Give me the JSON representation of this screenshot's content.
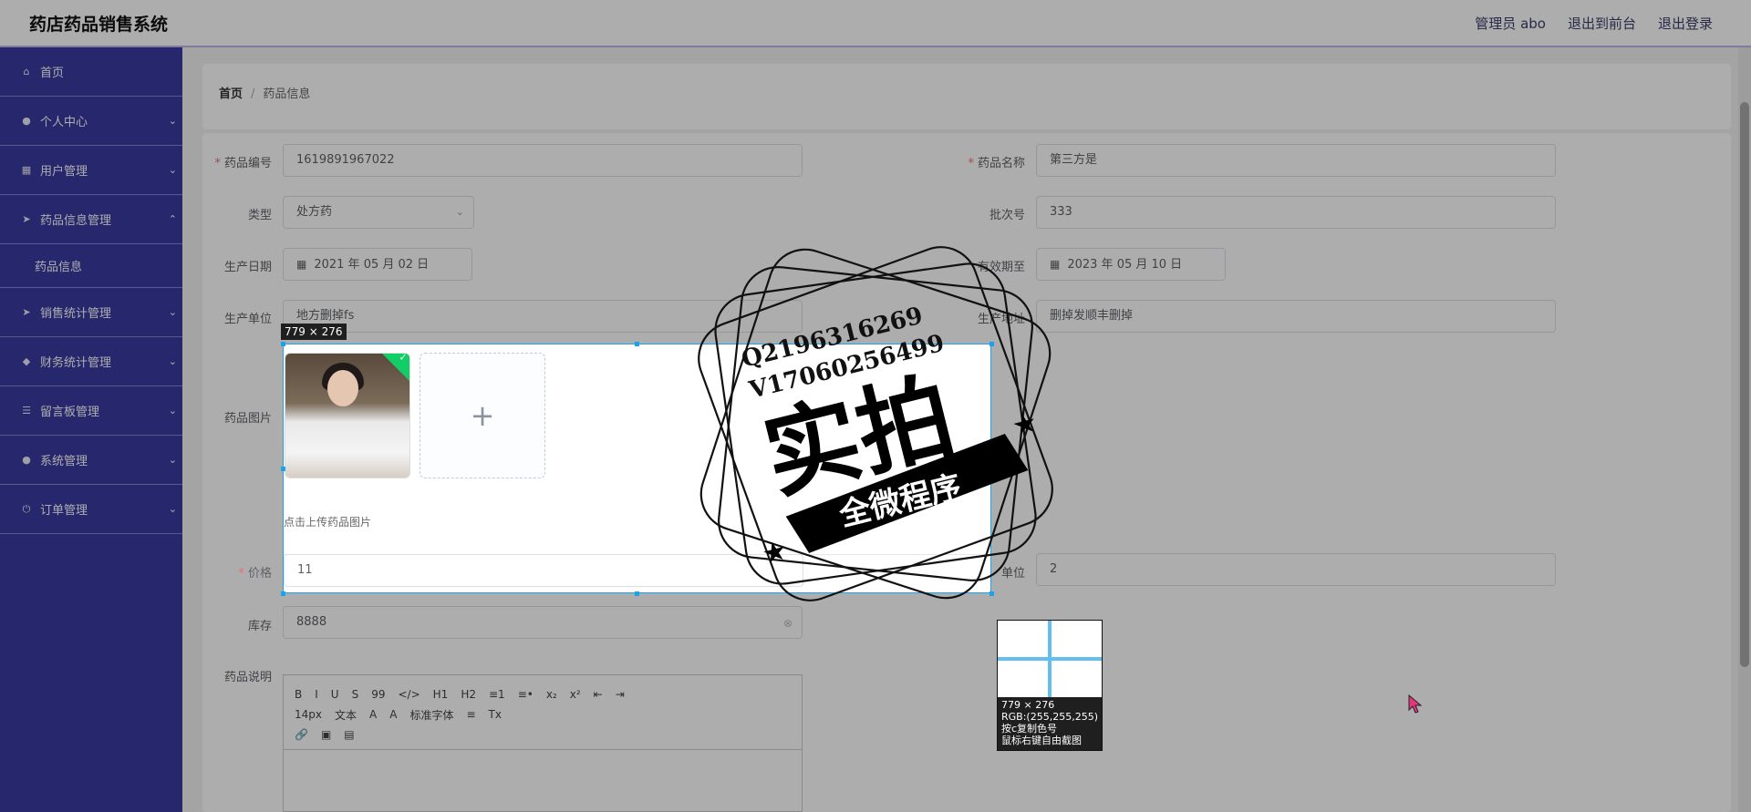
{
  "app": {
    "title": "药店药品销售系统",
    "nav": [
      "管理员 abo",
      "退出到前台",
      "退出登录"
    ]
  },
  "sidebar": {
    "items": [
      {
        "label": "首页",
        "icon": "home-icon"
      },
      {
        "label": "个人中心",
        "icon": "user-icon"
      },
      {
        "label": "用户管理",
        "icon": "grid-icon"
      },
      {
        "label": "药品信息管理",
        "icon": "send-icon"
      },
      {
        "label": "销售统计管理",
        "icon": "send-icon"
      },
      {
        "label": "财务统计管理",
        "icon": "shield-icon"
      },
      {
        "label": "留言板管理",
        "icon": "list-icon"
      },
      {
        "label": "系统管理",
        "icon": "mic-icon"
      },
      {
        "label": "订单管理",
        "icon": "power-icon"
      }
    ],
    "submenu": {
      "label": "药品信息"
    }
  },
  "breadcrumb": {
    "home": "首页",
    "sep": "/",
    "current": "药品信息"
  },
  "form": {
    "code_label": "药品编号",
    "code_value": "1619891967022",
    "name_label": "药品名称",
    "name_value": "第三方是",
    "type_label": "类型",
    "type_value": "处方药",
    "batch_label": "批次号",
    "batch_value": "333",
    "prod_date_label": "生产日期",
    "prod_date_value": "2021 年 05 月 02 日",
    "expiry_label": "有效期至",
    "expiry_value": "2023 年 05 月 10 日",
    "maker_label": "生产单位",
    "maker_value": "地方删掉fs",
    "address_label": "生产地址",
    "address_value": "删掉发顺丰删掉",
    "image_label": "药品图片",
    "upload_tip": "点击上传药品图片",
    "price_label": "价格",
    "price_value": "11",
    "unit_label": "单位",
    "unit_value": "2",
    "stock_label": "库存",
    "stock_value": "8888",
    "desc_label": "药品说明"
  },
  "editor": {
    "row1": [
      "B",
      "I",
      "U",
      "S",
      "99",
      "</>",
      "H1",
      "H2",
      "≡1",
      "≡•",
      "x₂",
      "x²",
      "⇤",
      "⇥"
    ],
    "row2": [
      "14px",
      "文本",
      "A",
      "A",
      "标准字体",
      "≡",
      "Tx"
    ],
    "row3": [
      "🔗",
      "▣",
      "▤"
    ]
  },
  "screenshot_tool": {
    "size_label": "779 × 276",
    "mag_size": "779 × 276",
    "mag_rgb": "RGB:(255,255,255)",
    "mag_hint1": "按c复制色号",
    "mag_hint2": "鼠标右键自由截图"
  },
  "watermark": {
    "qq": "Q2196316269",
    "vx": "V17060256499",
    "main": "实拍",
    "ribbon": "全微程序"
  }
}
